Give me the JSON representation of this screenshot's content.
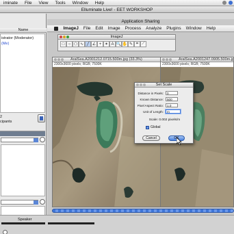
{
  "system_menu": {
    "items": [
      "Elluminate",
      "File",
      "View",
      "Tools",
      "Window",
      "Help"
    ],
    "visible_items": [
      "iminate",
      "File",
      "View",
      "Tools",
      "Window",
      "Help"
    ]
  },
  "elluminate": {
    "window_title": "Elluminate Live! - EET WORKSHOP"
  },
  "participants": {
    "header": "Name",
    "moderator_row": "istrator (Moderator)",
    "self_row": "(Me)",
    "count": "2",
    "count_label": "cipants"
  },
  "audio": {
    "speaker_label": "Speaker"
  },
  "app_sharing": {
    "title": "Application Sharing"
  },
  "imagej_menu": {
    "items": [
      "ImageJ",
      "File",
      "Edit",
      "Image",
      "Process",
      "Analyze",
      "Plugins",
      "Window",
      "Help"
    ]
  },
  "imagej_toolbar": {
    "title": "ImageJ",
    "tools": [
      "rect-tool",
      "oval-tool",
      "poly-tool",
      "freehand-tool",
      "line-tool",
      "angle-tool",
      "point-tool",
      "wand-tool",
      "text-tool",
      "zoom-tool",
      "hand-tool",
      "dropper-tool",
      "extra-tool",
      "pencil-tool"
    ],
    "tool_glyphs": [
      "□",
      "○",
      "⬠",
      "∿",
      "╱",
      "∠",
      "+",
      "✶",
      "A",
      "🔍",
      "✋",
      "✎",
      "⌗",
      "⟋"
    ],
    "active_tool_index": 4
  },
  "image_windows": [
    {
      "title": "AralSea.A2001212.0715.500m.jpg (33.3%)",
      "info": "2300x3600 pixels; RGB; 7500K"
    },
    {
      "title": "AralSea.A2001247.0905.500m.jpg",
      "info": "2300x3600 pixels; RGB; 7500K"
    }
  ],
  "set_scale": {
    "title": "Set Scale",
    "fields": [
      {
        "label": "Distance in Pixels:",
        "value": "0"
      },
      {
        "label": "Known Distance:",
        "value": "500"
      },
      {
        "label": "Pixel Aspect Ratio:",
        "value": "1.0"
      },
      {
        "label": "Unit of Length:",
        "value": "m"
      }
    ],
    "scale_text": "Scale: 0.002 pixels/m",
    "global_label": "Global",
    "global_checked": true,
    "cancel_label": "Cancel",
    "ok_label": "OK"
  },
  "colors": {
    "accent": "#3e74d6",
    "link": "#2a4fd1"
  }
}
